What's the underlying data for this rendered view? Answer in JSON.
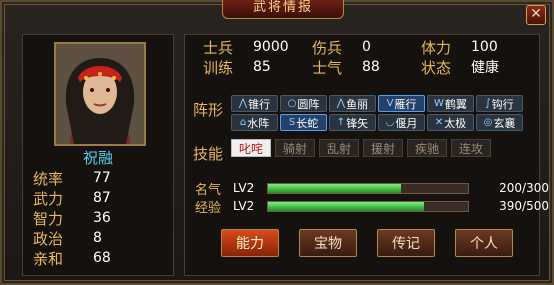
{
  "window": {
    "title": "武将情报",
    "close_icon": "close-icon"
  },
  "hero": {
    "name": "祝融",
    "stats": [
      {
        "label": "统率",
        "value": "77"
      },
      {
        "label": "武力",
        "value": "87"
      },
      {
        "label": "智力",
        "value": "36"
      },
      {
        "label": "政治",
        "value": "8"
      },
      {
        "label": "亲和",
        "value": "68"
      }
    ]
  },
  "info": {
    "soldiers_label": "士兵",
    "soldiers": "9000",
    "wounded_label": "伤兵",
    "wounded": "0",
    "stamina_label": "体力",
    "stamina": "100",
    "training_label": "训练",
    "training": "85",
    "morale_label": "士气",
    "morale": "88",
    "status_label": "状态",
    "status": "健康"
  },
  "formation": {
    "label": "阵形",
    "items": [
      {
        "glyph": "⋀",
        "label": "锥行",
        "active": false
      },
      {
        "glyph": "○",
        "label": "圆阵",
        "active": false
      },
      {
        "glyph": "⋀",
        "label": "鱼丽",
        "active": false
      },
      {
        "glyph": "V",
        "label": "雁行",
        "active": true
      },
      {
        "glyph": "W",
        "label": "鹤翼",
        "active": false
      },
      {
        "glyph": "∫",
        "label": "钩行",
        "active": false
      },
      {
        "glyph": "⌂",
        "label": "水阵",
        "active": false
      },
      {
        "glyph": "S",
        "label": "长蛇",
        "active": true
      },
      {
        "glyph": "↑",
        "label": "锋矢",
        "active": false
      },
      {
        "glyph": "◡",
        "label": "偃月",
        "active": false
      },
      {
        "glyph": "✕",
        "label": "太极",
        "active": false
      },
      {
        "glyph": "◎",
        "label": "玄襄",
        "active": false
      }
    ]
  },
  "skills": {
    "label": "技能",
    "items": [
      {
        "label": "叱咤",
        "active": true
      },
      {
        "label": "骑射",
        "active": false
      },
      {
        "label": "乱射",
        "active": false
      },
      {
        "label": "援射",
        "active": false
      },
      {
        "label": "疾驰",
        "active": false
      },
      {
        "label": "连攻",
        "active": false
      }
    ]
  },
  "progress": {
    "fame": {
      "label": "名气",
      "level": "LV2",
      "text": "200/300",
      "fraction": 0.667
    },
    "exp": {
      "label": "经验",
      "level": "LV2",
      "text": "390/500",
      "fraction": 0.78
    }
  },
  "buttons": {
    "ability": "能力",
    "treasure": "宝物",
    "biography": "传记",
    "personal": "个人"
  },
  "colors": {
    "accent": "#e8b85a",
    "name": "#5ad0f0",
    "bar": "#2eb43a"
  }
}
